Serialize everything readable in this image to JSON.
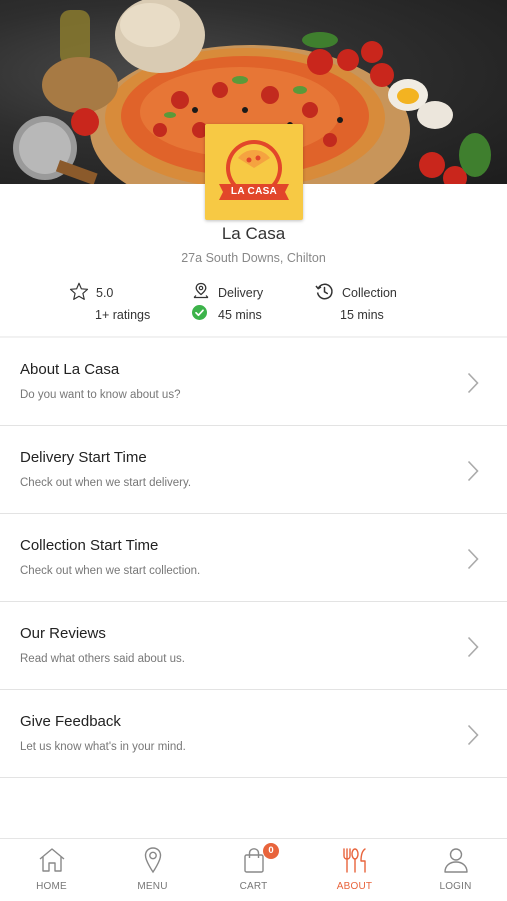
{
  "restaurant": {
    "name": "La Casa",
    "address": "27a South Downs, Chilton",
    "logo_text": "LA CASA"
  },
  "stats": {
    "rating_value": "5.0",
    "rating_count": "1+ ratings",
    "delivery_label": "Delivery",
    "delivery_time": "45 mins",
    "collection_label": "Collection",
    "collection_time": "15 mins"
  },
  "menu": [
    {
      "title": "About La Casa",
      "subtitle": "Do you want to know about us?"
    },
    {
      "title": "Delivery Start Time",
      "subtitle": "Check out when we start delivery."
    },
    {
      "title": "Collection Start Time",
      "subtitle": "Check out when we start collection."
    },
    {
      "title": "Our Reviews",
      "subtitle": "Read what others said about us."
    },
    {
      "title": "Give Feedback",
      "subtitle": "Let us know what's in your mind."
    }
  ],
  "tabs": [
    {
      "label": "HOME",
      "icon": "home-icon"
    },
    {
      "label": "MENU",
      "icon": "location-pin-icon"
    },
    {
      "label": "CART",
      "icon": "shopping-bag-icon",
      "badge": "0"
    },
    {
      "label": "ABOUT",
      "icon": "fork-knife-icon",
      "active": true
    },
    {
      "label": "LOGIN",
      "icon": "user-icon"
    }
  ],
  "colors": {
    "accent": "#e8643c",
    "logo_background": "#f7c944",
    "check_green": "#3cb34a"
  }
}
